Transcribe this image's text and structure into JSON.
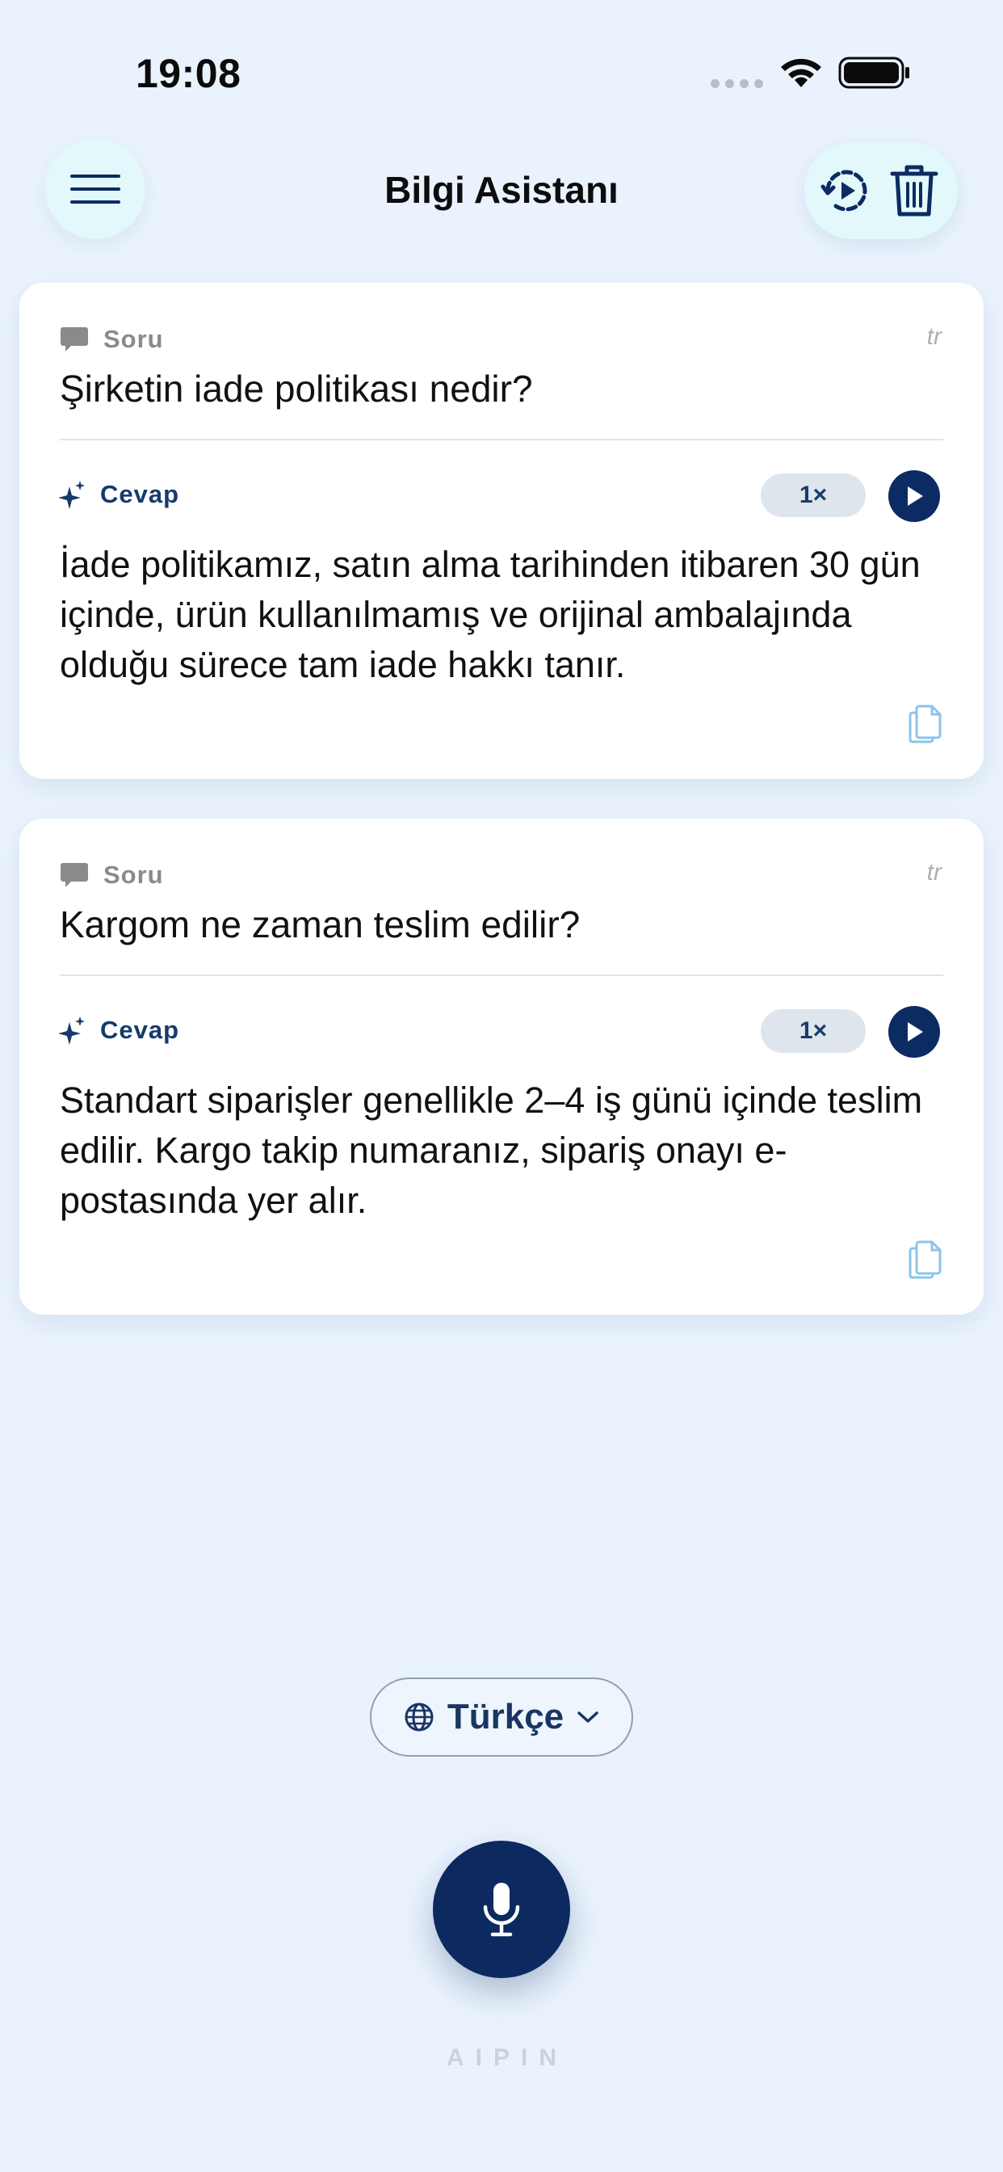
{
  "status_bar": {
    "time": "19:08"
  },
  "header": {
    "title": "Bilgi Asistanı",
    "menu_icon": "hamburger-icon",
    "replay_icon": "replay-icon",
    "delete_icon": "trash-icon"
  },
  "conversations": [
    {
      "question_label": "Soru",
      "language_tag": "tr",
      "question": "Şirketin iade politikası nedir?",
      "answer_label": "Cevap",
      "speed": "1×",
      "answer": "İade politikamız, satın alma tarihinden itibaren 30 gün içinde, ürün kullanılmamış ve orijinal ambalajında olduğu sürece tam iade hakkı tanır."
    },
    {
      "question_label": "Soru",
      "language_tag": "tr",
      "question": "Kargom ne zaman teslim edilir?",
      "answer_label": "Cevap",
      "speed": "1×",
      "answer": "Standart siparişler genellikle 2–4 iş günü içinde teslim edilir. Kargo takip numaranız, sipariş onayı e-postasında yer alır."
    }
  ],
  "language_selector": {
    "label": "Türkçe",
    "icon": "globe-icon"
  },
  "mic": {
    "icon": "microphone-icon"
  },
  "brand": "AIPIN",
  "colors": {
    "background": "#eaf3fd",
    "accent": "#0b2b62",
    "button_bg": "#e3f8fb"
  }
}
